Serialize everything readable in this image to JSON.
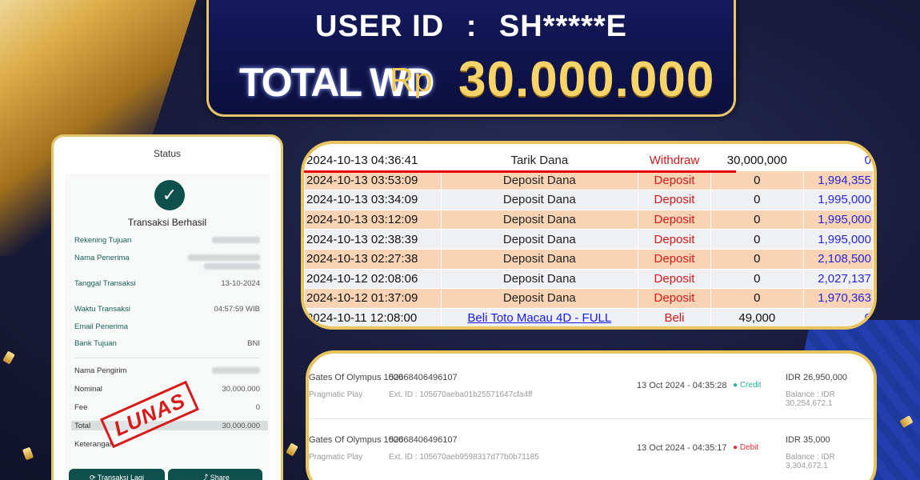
{
  "header": {
    "user_id_label": "USER ID",
    "colon": ":",
    "user_id_value": "SH*****E",
    "total_label": "TOTAL WD",
    "currency": "Rp",
    "amount": "30.000.000"
  },
  "receipt": {
    "title": "Status",
    "status_text": "Transaksi Berhasil",
    "fields": {
      "rekening_tujuan": "Rekening Tujuan",
      "nama_penerima": "Nama Penerima",
      "tanggal_transaksi": "Tanggal Transaksi",
      "tanggal_value": "13-10-2024",
      "waktu_transaksi": "Waktu Transaksi",
      "waktu_value": "04:57:59 WIB",
      "email_penerima": "Email Penerima",
      "bank_tujuan": "Bank Tujuan",
      "bank_value": "BNI",
      "nama_pengirim": "Nama Pengirim",
      "nominal": "Nominal",
      "nominal_value": "30.000.000",
      "fee": "Fee",
      "fee_value": "0",
      "total": "Total",
      "total_value": "30.000.000",
      "keterangan": "Keterangan"
    },
    "stamp": "LUNAS",
    "buttons": {
      "transaksi_lagi": "Transaksi Lagi",
      "share": "Share"
    }
  },
  "history": {
    "rows": [
      {
        "date": "2024-10-13 04:36:41",
        "desc": "Tarik Dana",
        "type": "Withdraw",
        "amount": "30,000,000",
        "balance": "0",
        "link": false
      },
      {
        "date": "2024-10-13 03:53:09",
        "desc": "Deposit Dana",
        "type": "Deposit",
        "amount": "0",
        "balance": "1,994,355",
        "link": false
      },
      {
        "date": "2024-10-13 03:34:09",
        "desc": "Deposit Dana",
        "type": "Deposit",
        "amount": "0",
        "balance": "1,995,000",
        "link": false
      },
      {
        "date": "2024-10-13 03:12:09",
        "desc": "Deposit Dana",
        "type": "Deposit",
        "amount": "0",
        "balance": "1,995,000",
        "link": false
      },
      {
        "date": "2024-10-13 02:38:39",
        "desc": "Deposit Dana",
        "type": "Deposit",
        "amount": "0",
        "balance": "1,995,000",
        "link": false
      },
      {
        "date": "2024-10-13 02:27:38",
        "desc": "Deposit Dana",
        "type": "Deposit",
        "amount": "0",
        "balance": "2,108,500",
        "link": false
      },
      {
        "date": "2024-10-12 02:08:06",
        "desc": "Deposit Dana",
        "type": "Deposit",
        "amount": "0",
        "balance": "2,027,137",
        "link": false
      },
      {
        "date": "2024-10-12 01:37:09",
        "desc": "Deposit Dana",
        "type": "Deposit",
        "amount": "0",
        "balance": "1,970,363",
        "link": false
      },
      {
        "date": "2024-10-11 12:08:00",
        "desc": "Beli Toto Macau 4D - FULL",
        "type": "Beli",
        "amount": "49,000",
        "balance": "0",
        "link": true
      }
    ]
  },
  "games": [
    {
      "name": "Gates Of Olympus 1000",
      "provider": "Pragmatic Play",
      "id": "52668406496107",
      "ext": "Ext. ID : 105670aeba01b25571647cfa4ff",
      "time": "13 Oct 2024 - 04:35:28",
      "status": "Credit",
      "amount": "IDR 26,950,000",
      "balance": "Balance : IDR 30,254,672.1"
    },
    {
      "name": "Gates Of Olympus 1000",
      "provider": "Pragmatic Play",
      "id": "52668406496107",
      "ext": "Ext. ID : 105670aeb9598317d77b0b71185",
      "time": "13 Oct 2024 - 04:35:17",
      "status": "Debit",
      "amount": "IDR 35,000",
      "balance": "Balance : IDR 3,304,672.1"
    }
  ],
  "colors": {
    "gold": "#e8c45f",
    "navy": "#0b0f3e",
    "teal": "#0f4f4c",
    "credit": "#2bb39a",
    "debit": "#e3342f"
  },
  "icons": {
    "check": "check-circle-icon",
    "refresh": "refresh-icon",
    "share": "share-icon"
  }
}
